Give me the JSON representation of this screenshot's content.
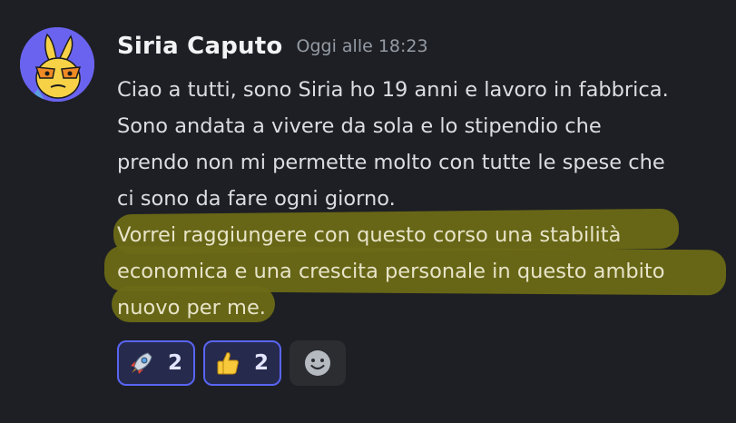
{
  "message": {
    "username": "Siria Caputo",
    "timestamp": "Oggi alle 18:23",
    "lines": [
      "Ciao a tutti, sono Siria ho 19 anni e lavoro in fabbrica.",
      "Sono andata a vivere da sola e lo stipendio che",
      "prendo non mi permette molto con tutte le spese che",
      "ci sono da fare ogni giorno.",
      "Vorrei raggiungere con questo corso una stabilità",
      "economica e una crescita personale in questo ambito",
      "nuovo per me."
    ]
  },
  "reactions": [
    {
      "emoji": "rocket-icon",
      "count": "2"
    },
    {
      "emoji": "thumbs-up-icon",
      "count": "2"
    }
  ],
  "colors": {
    "background": "#1e1f24",
    "highlight": "#6b6a16",
    "reaction_border": "#5865f2"
  }
}
